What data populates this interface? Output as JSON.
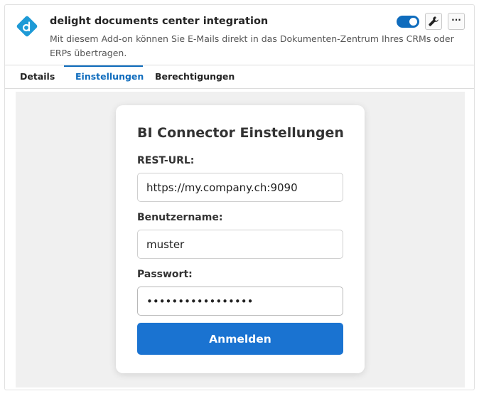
{
  "app": {
    "title": "delight documents center integration",
    "description": "Mit diesem Add-on können Sie E-Mails direkt in das Dokumenten-Zentrum Ihres CRMs oder ERPs übertragen.",
    "enabled": true,
    "logo_icon": "diamond-d-logo",
    "accent_color": "#0f6cbd",
    "logo_color": "#1e9ad6"
  },
  "header_actions": {
    "settings_icon": "wrench-icon",
    "more_label": "···"
  },
  "tabs": [
    {
      "label": "Details",
      "active": false
    },
    {
      "label": "Einstellungen",
      "active": true
    },
    {
      "label": "Berechtigungen",
      "active": false
    }
  ],
  "login": {
    "title": "BI Connector Einstellungen",
    "rest_url_label": "REST-URL:",
    "rest_url_value": "https://my.company.ch:9090",
    "username_label": "Benutzername:",
    "username_value": "muster",
    "password_label": "Passwort:",
    "password_value": "xxxxxxxxxxxxxxxxx",
    "submit_label": "Anmelden",
    "button_color": "#1a73d1"
  }
}
